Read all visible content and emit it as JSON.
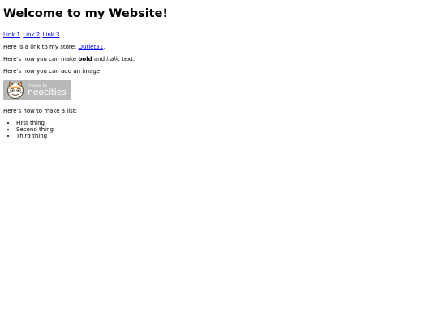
{
  "page": {
    "heading": "Welcome to my Website!",
    "nav_links": [
      "Link 1",
      "Link 2",
      "Link 3"
    ],
    "store_text_before": "Here is a link to my store: ",
    "store_link_label": "Outlet31",
    "store_text_after": ".",
    "format_text_1": "Here's how you can make ",
    "format_bold": "bold",
    "format_text_2": " and ",
    "format_italic": "italic",
    "format_text_3": " text.",
    "image_text": "Here's how you can add an image:",
    "badge": {
      "small_text": "hosted by",
      "brand_text": "neocities",
      "icon": "neocities-cat-icon"
    },
    "list_intro": "Here's how to make a list:",
    "list_items": [
      "First thing",
      "Second thing",
      "Third thing"
    ]
  },
  "colors": {
    "link": "#0000ee",
    "badge_bg": "#b9b9b9",
    "cat_orange": "#f2a84a"
  }
}
